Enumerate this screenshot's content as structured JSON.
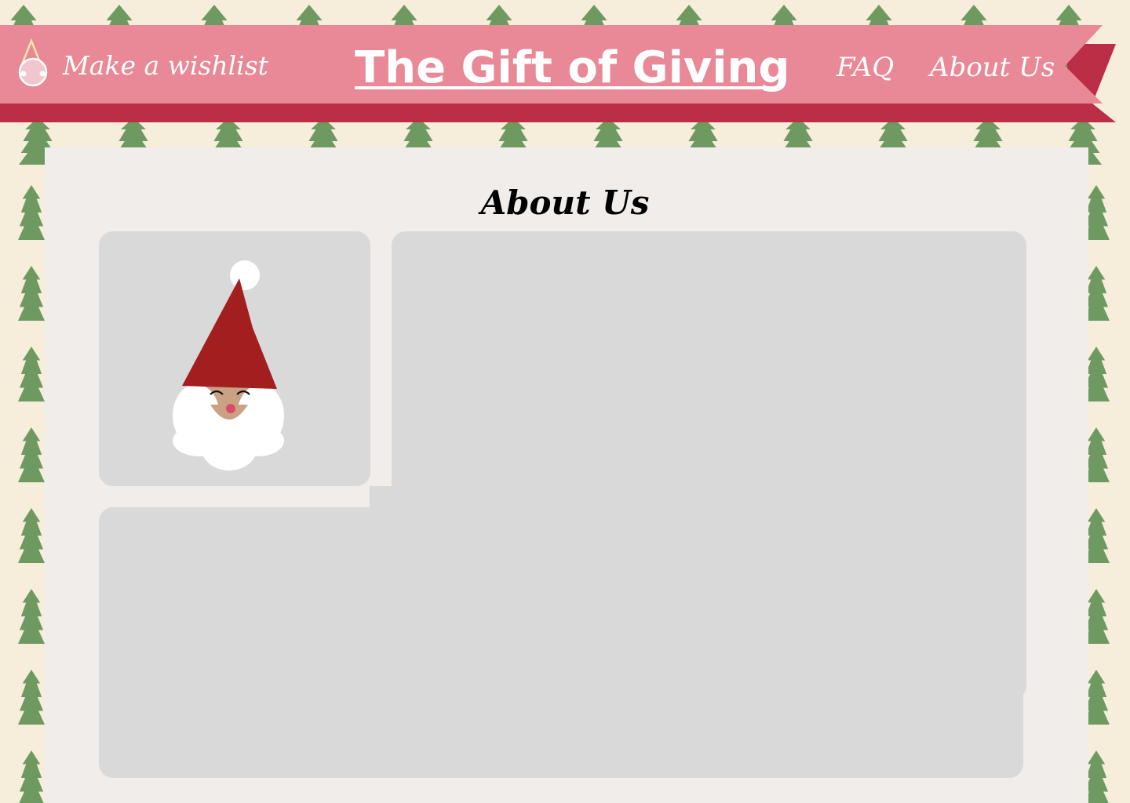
{
  "header": {
    "wishlist_label": "Make a wishlist",
    "brand_title": "The Gift of Giving",
    "faq_label": "FAQ",
    "about_label": "About Us"
  },
  "main": {
    "title": "About Us"
  },
  "colors": {
    "background": "#f6edda",
    "tree": "#6e9a62",
    "ribbon_pink": "#e98896",
    "ribbon_red": "#bb2e46",
    "card": "#f0edeb",
    "panel": "#d9d9d9",
    "santa_hat": "#a31e1f",
    "santa_skin": "#c9a285"
  },
  "icons": {
    "logo": "elf-head-icon",
    "portrait": "santa-face-icon",
    "background_pattern": "pine-tree-icon"
  }
}
